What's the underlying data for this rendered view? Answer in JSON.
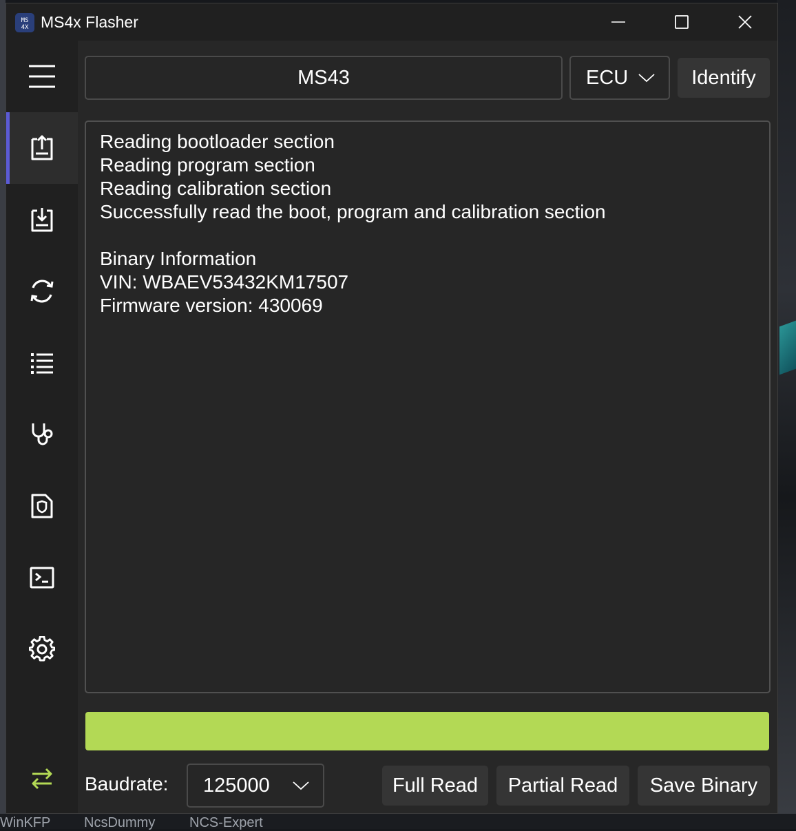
{
  "window": {
    "title": "MS4x Flasher",
    "icon_text_top": "MS",
    "icon_text_bottom": "4X"
  },
  "sidebar": {
    "items": [
      {
        "icon": "menu-icon"
      },
      {
        "icon": "upload-icon",
        "active": true
      },
      {
        "icon": "download-icon"
      },
      {
        "icon": "refresh-icon"
      },
      {
        "icon": "list-icon"
      },
      {
        "icon": "stethoscope-icon"
      },
      {
        "icon": "document-shield-icon"
      },
      {
        "icon": "terminal-icon"
      },
      {
        "icon": "settings-icon"
      },
      {
        "icon": "swap-arrows-icon",
        "color": "#b3d955"
      }
    ]
  },
  "header": {
    "ecu_name": "MS43",
    "ecu_select_value": "ECU",
    "identify_label": "Identify"
  },
  "log": {
    "lines": [
      "Reading bootloader section",
      "Reading program section",
      "Reading calibration section",
      "Successfully read the boot, program and calibration section",
      "",
      "Binary Information",
      "VIN: WBAEV53432KM17507",
      "Firmware version: 430069"
    ]
  },
  "progress": {
    "percent": 100,
    "color": "#b3d955"
  },
  "footer": {
    "baudrate_label": "Baudrate:",
    "baudrate_value": "125000",
    "full_read_label": "Full Read",
    "partial_read_label": "Partial Read",
    "save_binary_label": "Save Binary"
  },
  "taskbar": {
    "items": [
      "WinKFP",
      "NcsDummy",
      "NCS-Expert"
    ]
  },
  "colors": {
    "accent": "#5b5bd6",
    "progress": "#b3d955",
    "window_bg": "#272727",
    "sidebar_bg": "#202020"
  }
}
